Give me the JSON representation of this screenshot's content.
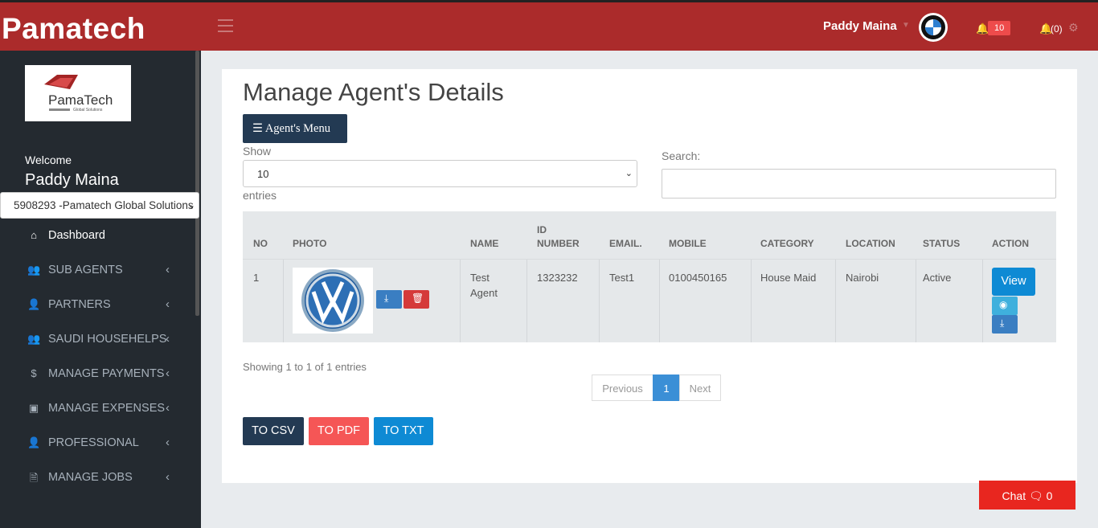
{
  "topbar": {
    "brand": "Pamatech",
    "user_name": "Paddy Maina",
    "notification_badge": "10",
    "alerts_count": "(0)"
  },
  "sidebar": {
    "logo_text": "PamaTech",
    "logo_subtext": "Global Solutions",
    "welcome": "Welcome",
    "user_name": "Paddy Maina",
    "company_select": "5908293 -Pamatech Global Solutions",
    "items": [
      {
        "label": "Dashboard",
        "icon": "home-icon"
      },
      {
        "label": "SUB AGENTS",
        "icon": "users-icon"
      },
      {
        "label": "PARTNERS",
        "icon": "user-icon"
      },
      {
        "label": "SAUDI HOUSEHELPS",
        "icon": "users-icon"
      },
      {
        "label": "MANAGE PAYMENTS",
        "icon": "dollar-icon"
      },
      {
        "label": "MANAGE EXPENSES",
        "icon": "money-icon"
      },
      {
        "label": "PROFESSIONAL",
        "icon": "user-icon"
      },
      {
        "label": "MANAGE JOBS",
        "icon": "file-icon"
      }
    ]
  },
  "main": {
    "title": "Manage Agent's Details",
    "menu_button": "Agent's Menu",
    "show_label": "Show",
    "show_value": "10",
    "entries_label": "entries",
    "search_label": "Search:",
    "search_value": "",
    "table": {
      "headers": [
        "NO",
        "PHOTO",
        "NAME",
        "ID NUMBER",
        "EMAIL.",
        "MOBILE",
        "CATEGORY",
        "LOCATION",
        "STATUS",
        "ACTION"
      ],
      "rows": [
        {
          "no": "1",
          "name": "Test Agent",
          "id_number": "1323232",
          "email": "Test1",
          "mobile": "0100450165",
          "category": "House Maid",
          "location": "Nairobi",
          "status": "Active",
          "action": "View"
        }
      ]
    },
    "info": "Showing 1 to 1 of 1 entries",
    "pagination": {
      "previous": "Previous",
      "current": "1",
      "next": "Next"
    },
    "export": {
      "csv": "TO CSV",
      "pdf": "TO PDF",
      "txt": "TO TXT"
    }
  },
  "chat": {
    "label": "Chat",
    "count": "0"
  },
  "colors": {
    "topbar": "#ab2b2b",
    "sidebar": "#242a30",
    "primary": "#233a53",
    "accent_blue": "#0e8ad4",
    "danger": "#e8261f"
  }
}
